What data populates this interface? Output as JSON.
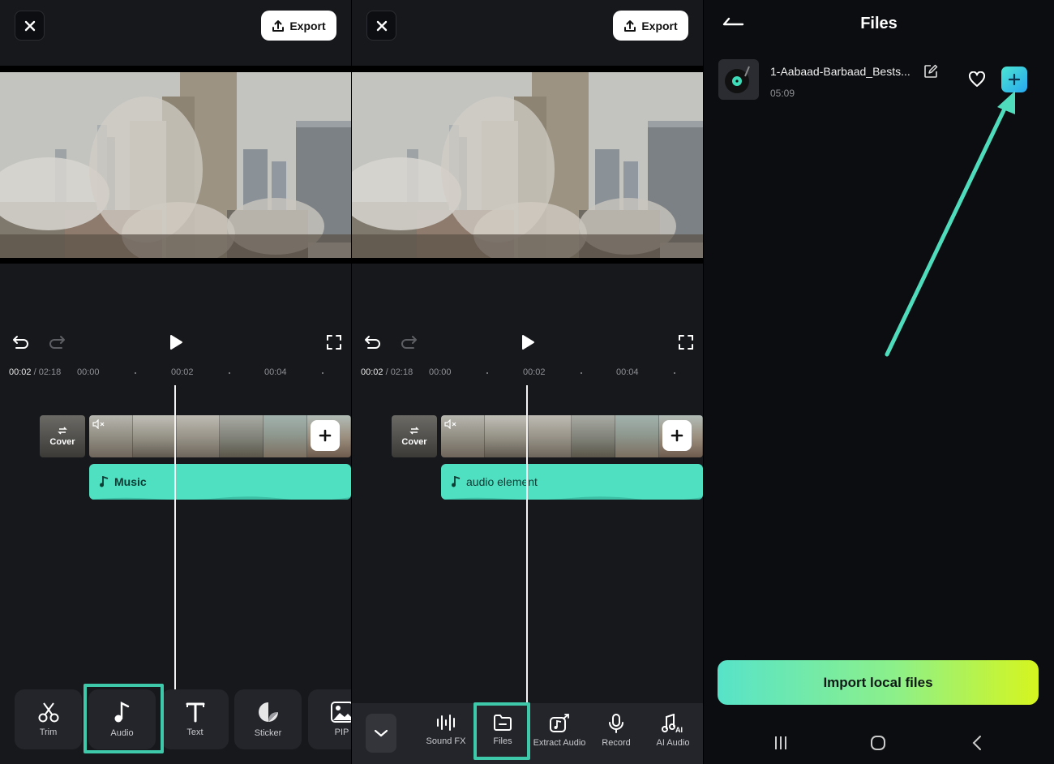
{
  "editor": {
    "export_label": "Export",
    "current_time": "00:02",
    "total_time": " / 02:18",
    "ruler_ticks": [
      "00:00",
      "00:02",
      "00:04"
    ],
    "cover_label": "Cover",
    "audio_track_label_1": "Music",
    "audio_track_label_2": "audio element"
  },
  "toolbar1": {
    "items": [
      {
        "label": "Trim",
        "icon": "scissors-icon"
      },
      {
        "label": "Audio",
        "icon": "music-note-icon",
        "highlighted": true
      },
      {
        "label": "Text",
        "icon": "text-icon"
      },
      {
        "label": "Sticker",
        "icon": "sticker-icon"
      },
      {
        "label": "PIP",
        "icon": "pip-icon"
      }
    ]
  },
  "toolbar2": {
    "items": [
      {
        "label": "Sound FX",
        "icon": "sound-fx-icon"
      },
      {
        "label": "Files",
        "icon": "folder-icon",
        "highlighted": true
      },
      {
        "label": "Extract Audio",
        "icon": "extract-audio-icon"
      },
      {
        "label": "Record",
        "icon": "microphone-icon"
      },
      {
        "label": "AI Audio",
        "icon": "ai-audio-icon"
      }
    ]
  },
  "files": {
    "title": "Files",
    "item": {
      "name": "1-Aabaad-Barbaad_Bests...",
      "duration": "05:09"
    },
    "import_label": "Import local files"
  },
  "colors": {
    "accent": "#4fe0c2",
    "highlight_border": "#3ecaaa",
    "annotation_arrow": "#4fdcbc"
  }
}
